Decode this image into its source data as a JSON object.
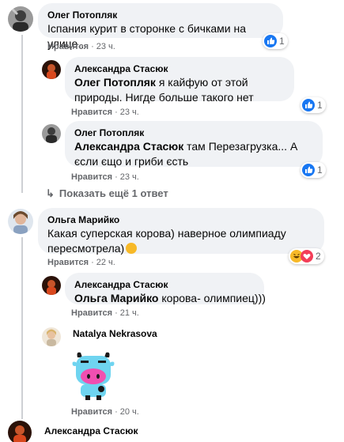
{
  "comments": [
    {
      "author": "Олег Потопляк",
      "text": "Іспания курит в сторонке с бичками на улице...",
      "like": "Нравится",
      "time": "23 ч.",
      "reactions": "1"
    },
    {
      "author": "Александра Стасюк",
      "mention": "Олег Потопляк",
      "text": " я кайфую от этой природы. Нигде больше такого нет",
      "like": "Нравится",
      "time": "23 ч.",
      "reactions": "1"
    },
    {
      "author": "Олег Потопляк",
      "mention": "Александра Стасюк",
      "text": " там Перезагрузка... А єсли єщо и гриби єсть",
      "like": "Нравится",
      "time": "23 ч.",
      "reactions": "1"
    },
    {
      "show_more": "Показать ещё 1 ответ"
    },
    {
      "author": "Ольга Марийко",
      "text": "Какая суперская корова) наверное олимпиаду пересмотрела)",
      "like": "Нравится",
      "time": "22 ч.",
      "reactions": "2"
    },
    {
      "author": "Александра Стасюк",
      "mention": "Ольга Марийко",
      "text": " корова- олимпиец)))",
      "like": "Нравится",
      "time": "21 ч."
    },
    {
      "author": "Natalya Nekrasova",
      "sticker": "pink-cow-sticker",
      "like": "Нравится",
      "time": "20 ч."
    },
    {
      "author": "Александра Стасюк"
    }
  ],
  "colors": {
    "bubble": "#f0f2f5",
    "meta": "#65676b",
    "like_blue": "#1877f2",
    "love_red": "#f33e58",
    "haha_yellow": "#f7b928"
  },
  "icons": [
    "like-reaction-icon",
    "haha-reaction-icon",
    "love-reaction-icon",
    "reply-arrow-icon"
  ]
}
